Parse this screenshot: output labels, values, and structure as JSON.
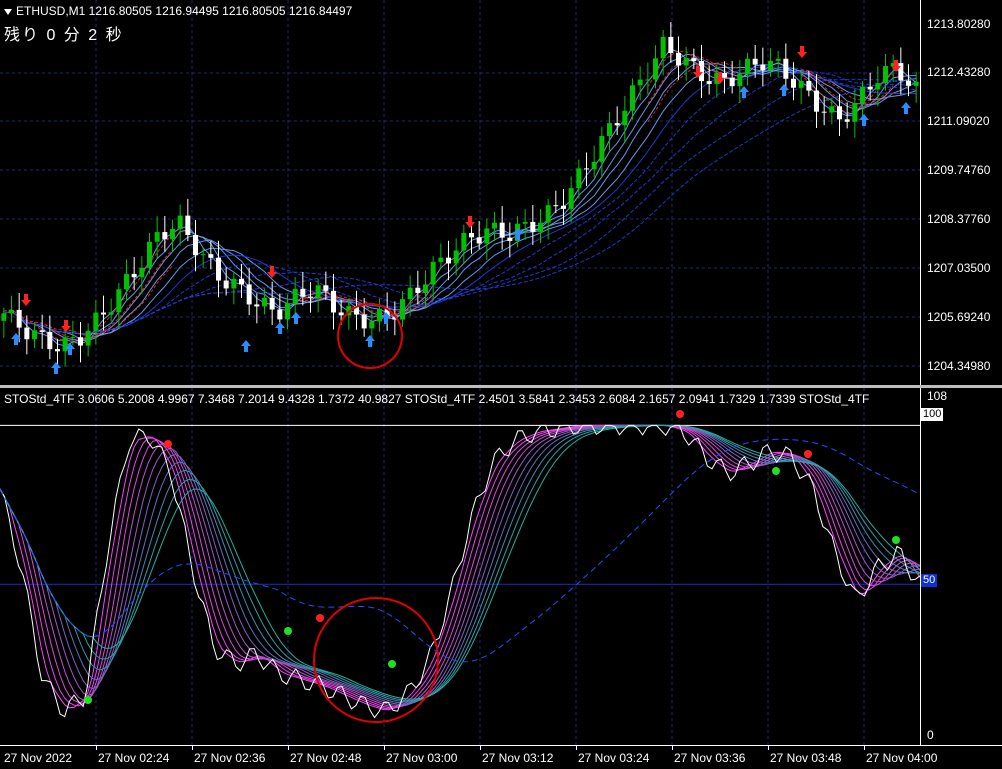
{
  "symbol_header": "ETHUSD,M1  1216.80505 1216.94495 1216.80505 1216.84497",
  "countdown": "残り 0 分 2 秒",
  "indicator_header": "STOStd_4TF 3.0606 5.2008 4.9967 7.3468 7.2014 9.4328 1.7372 40.9827  STOStd_4TF 2.4501 3.5841 2.3453 2.6084 2.1657 2.0941 1.7329 1.7339  STOStd_4TF",
  "price_scale": [
    "1213.80280",
    "1212.43280",
    "1211.09020",
    "1209.74760",
    "1208.37760",
    "1207.03500",
    "1205.69240",
    "1204.34980"
  ],
  "ind_scale": {
    "top": "108",
    "level100": "100",
    "level50": "50",
    "bottom": "0"
  },
  "time_labels": [
    "27 Nov 2022",
    "27 Nov 02:24",
    "27 Nov 02:36",
    "27 Nov 02:48",
    "27 Nov 03:00",
    "27 Nov 03:12",
    "27 Nov 03:24",
    "27 Nov 03:36",
    "27 Nov 03:48",
    "27 Nov 04:00"
  ],
  "colors": {
    "bull": "#00c000",
    "bear": "#ffffff",
    "up_arrow": "#2a8cff",
    "down_arrow": "#ff2020",
    "grid": "#1e2a6e",
    "circle": "#e00000",
    "level50": "#1432c8"
  },
  "chart_data": [
    {
      "type": "candlestick",
      "title": "ETHUSD,M1",
      "y_range": [
        1204.0,
        1214.2
      ],
      "ohlc_sample_close": [
        1205.9,
        1205.5,
        1205.2,
        1205.0,
        1205.3,
        1205.8,
        1206.5,
        1207.2,
        1208.0,
        1208.3,
        1207.6,
        1206.9,
        1206.6,
        1206.2,
        1205.9,
        1206.3,
        1206.6,
        1206.1,
        1205.8,
        1205.7,
        1205.9,
        1206.4,
        1207.0,
        1207.5,
        1207.9,
        1208.1,
        1208.0,
        1208.2,
        1208.5,
        1209.0,
        1209.8,
        1210.6,
        1211.4,
        1212.2,
        1213.0,
        1212.6,
        1212.2,
        1212.0,
        1212.3,
        1212.6,
        1212.4,
        1211.9,
        1211.4,
        1211.0,
        1211.5,
        1212.2,
        1212.4,
        1211.8
      ]
    },
    {
      "type": "line",
      "title": "STOStd_4TF",
      "y_range": [
        0,
        108
      ],
      "levels": [
        100,
        50
      ],
      "stoch_sample": [
        80,
        55,
        20,
        10,
        15,
        60,
        95,
        97,
        85,
        55,
        30,
        25,
        28,
        22,
        20,
        18,
        15,
        12,
        10,
        15,
        25,
        45,
        70,
        88,
        95,
        98,
        99,
        100,
        100,
        100,
        100,
        100,
        98,
        90,
        85,
        88,
        92,
        90,
        80,
        60,
        45,
        55,
        60,
        50
      ]
    }
  ]
}
